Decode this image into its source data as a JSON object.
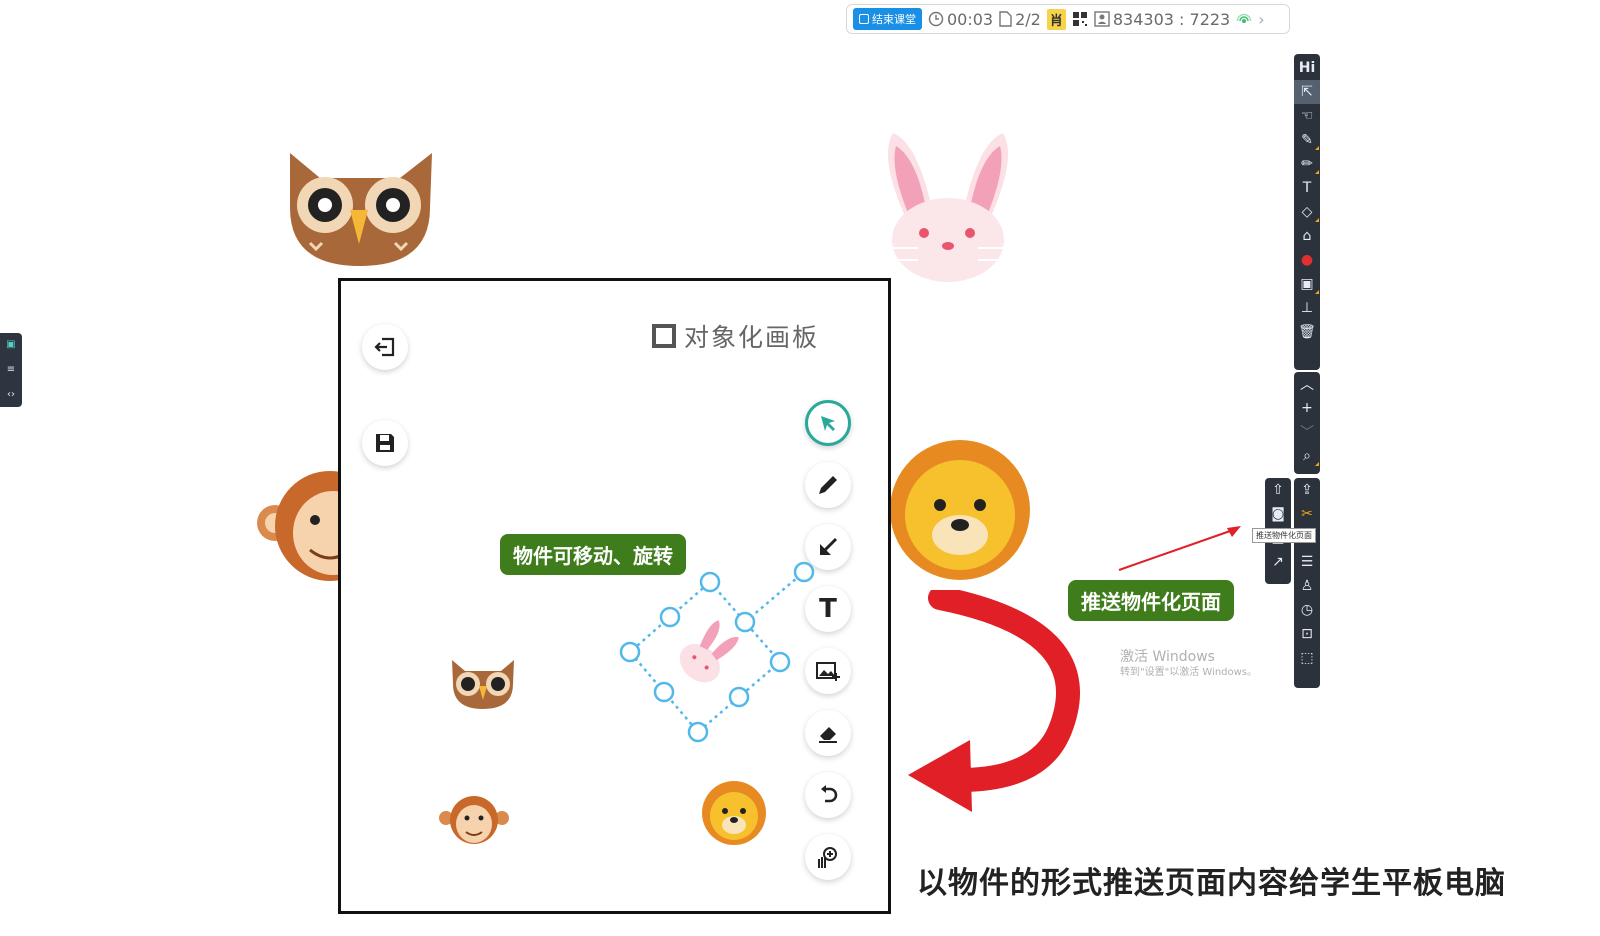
{
  "topbar": {
    "end_class": "结束课堂",
    "timer": "00:03",
    "pages": "2/2",
    "badge": "肖",
    "room": "834303 : 7223"
  },
  "board": {
    "title": "对象化画板",
    "move_label": "物件可移动、旋转"
  },
  "push_label": "推送物件化页面",
  "tooltip": "推送物件化页面",
  "caption": "以物件的形式推送页面内容给学生平板电脑",
  "watermark": {
    "line1": "激活 Windows",
    "line2": "转到\"设置\"以激活 Windows。"
  },
  "right_toolbar_label": "Hi",
  "colors": {
    "accent_blue": "#1a8fe6",
    "green_label": "#3f7c1b",
    "toolbar_dark": "#2b323c",
    "arrow_red": "#e01f26",
    "select_teal": "#2aa89a"
  }
}
